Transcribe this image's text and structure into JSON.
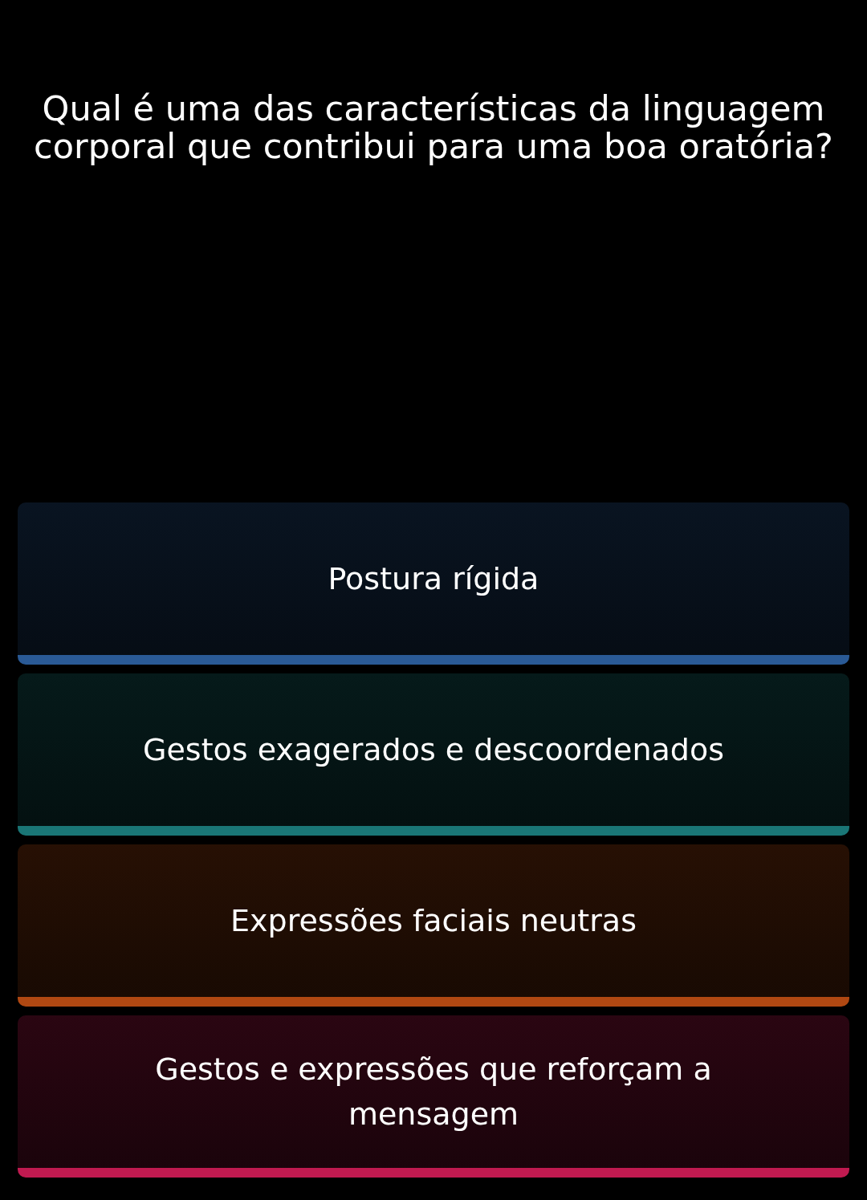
{
  "question": "Qual é uma das características da linguagem corporal que contribui para uma boa oratória?",
  "options": [
    {
      "label": "Postura rígida",
      "color": "#2a5a96"
    },
    {
      "label": "Gestos exagerados e descoordenados",
      "color": "#1a7676"
    },
    {
      "label": "Expressões faciais neutras",
      "color": "#b04812"
    },
    {
      "label": "Gestos e expressões que reforçam a mensagem",
      "color": "#c01a50"
    }
  ]
}
